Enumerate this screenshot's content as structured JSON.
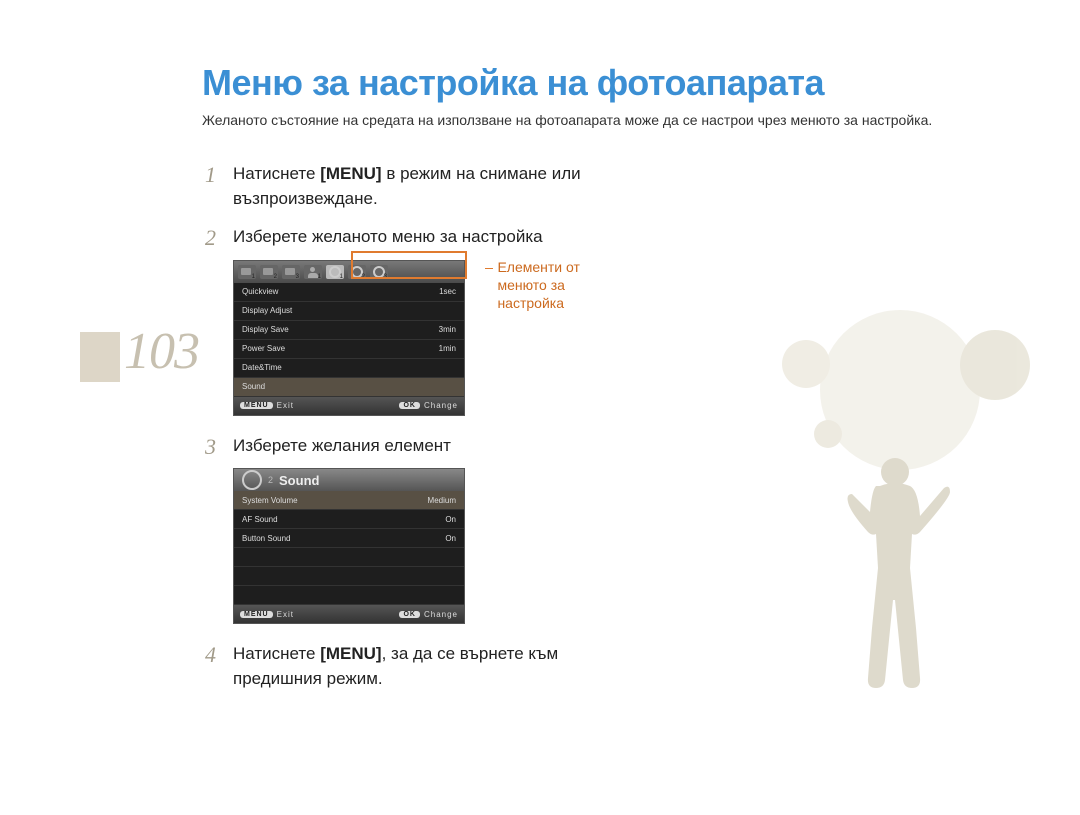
{
  "page_number": "103",
  "title": "Меню за настройка на фотоапарата",
  "subtitle": "Желаното състояние на средата на използване на фотоапарата може да се настрои чрез менюто за настройка.",
  "steps": {
    "s1": {
      "num": "1",
      "pre": "Натиснете ",
      "bold": "[MENU]",
      "post": " в режим на снимане или възпроизвеждане."
    },
    "s2": {
      "num": "2",
      "text": "Изберете желаното меню за настройка"
    },
    "s3": {
      "num": "3",
      "text": "Изберете желания елемент"
    },
    "s4": {
      "num": "4",
      "pre": "Натиснете ",
      "bold": "[MENU]",
      "post": ", за да се върнете към предишния режим."
    }
  },
  "callout": {
    "l1": "Елементи от",
    "l2": "менюто за",
    "l3": "настройка"
  },
  "screen1": {
    "tabs": {
      "c1": "1",
      "c2": "2",
      "c3": "3",
      "p1": "1",
      "g1": "1",
      "g2": "2",
      "g3": "3"
    },
    "rows": [
      {
        "label": "Quickview",
        "value": "1sec"
      },
      {
        "label": "Display Adjust",
        "value": ""
      },
      {
        "label": "Display Save",
        "value": "3min"
      },
      {
        "label": "Power Save",
        "value": "1min"
      },
      {
        "label": "Date&Time",
        "value": ""
      },
      {
        "label": "Sound",
        "value": ""
      }
    ],
    "footer": {
      "menu_btn": "MENU",
      "exit": "Exit",
      "ok_btn": "OK",
      "change": "Change"
    }
  },
  "screen2": {
    "title_sub": "2",
    "title": "Sound",
    "rows": [
      {
        "label": "System Volume",
        "value": "Medium"
      },
      {
        "label": "AF Sound",
        "value": "On"
      },
      {
        "label": "Button Sound",
        "value": "On"
      }
    ],
    "footer": {
      "menu_btn": "MENU",
      "exit": "Exit",
      "ok_btn": "OK",
      "change": "Change"
    }
  }
}
